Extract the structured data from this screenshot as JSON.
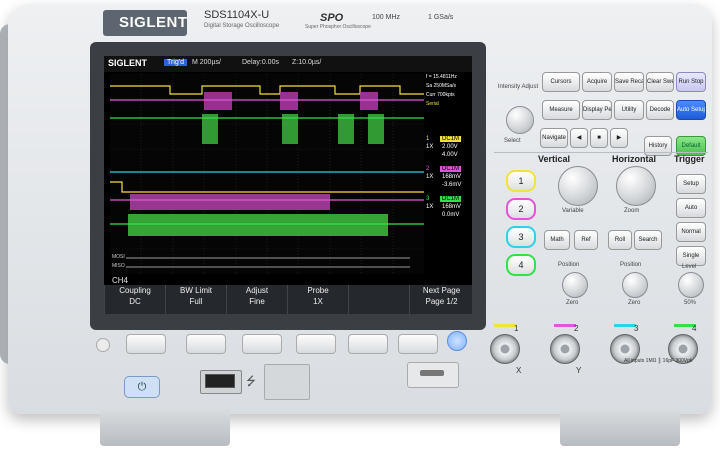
{
  "brand": "SIGLENT",
  "model": {
    "name": "SDS1104X-U",
    "subtitle": "Digital Storage Oscilloscope",
    "spo": "SPO",
    "spo_subtitle": "Super Phosphor Oscilloscope",
    "bandwidth": "100 MHz",
    "sample_rate": "1 GSa/s"
  },
  "screen": {
    "logo": "SIGLENT",
    "trig_status": "Trig'd",
    "timebase": "M 200µs/",
    "delay": "Delay:0.00s",
    "zoom": "Z:10.0µs/",
    "right_panel": {
      "freq": "f = 15.4811Hz",
      "sample": "Sa 250MSa/s",
      "curr": "Curr 700kpts",
      "trig": "Serial",
      "ch1_block": [
        "1",
        "1X",
        "DC1M",
        "2.00V",
        "4.00V"
      ],
      "ch2_block": [
        "2",
        "1X",
        "DC1M",
        "168mV",
        "-3.6mV"
      ],
      "ch3_block": [
        "3",
        "1X",
        "DC1M",
        "168mV",
        "0.0mV"
      ]
    },
    "bus_labels": [
      "MOSI",
      "MISO"
    ],
    "channel_label": "CH4",
    "menu": [
      {
        "top": "Coupling",
        "bottom": "DC"
      },
      {
        "top": "BW Limit",
        "bottom": "Full"
      },
      {
        "top": "Adjust",
        "bottom": "Fine"
      },
      {
        "top": "Probe",
        "bottom": "1X"
      },
      {
        "top": "",
        "bottom": ""
      },
      {
        "top": "Next Page",
        "bottom": "Page 1/2"
      }
    ]
  },
  "panel": {
    "intensity": "Intensity Adjust",
    "select": "Select",
    "buttons": {
      "cursors": "Cursors",
      "acquire": "Acquire",
      "save_recall": "Save Recall",
      "clear_sweeps": "Clear Sweeps",
      "run_stop": "Run Stop",
      "measure": "Measure",
      "display_persist": "Display Persist",
      "utility": "Utility",
      "decode": "Decode",
      "auto_setup": "Auto Setup",
      "navigate": "Navigate",
      "history": "History",
      "default": "Default",
      "math": "Math",
      "ref": "Ref",
      "roll": "Roll",
      "search": "Search",
      "setup": "Setup",
      "auto": "Auto",
      "normal": "Normal",
      "single": "Single"
    },
    "sections": {
      "vertical": "Vertical",
      "horizontal": "Horizontal",
      "trigger": "Trigger"
    },
    "knob_labels": {
      "variable": "Variable",
      "zoom": "Zoom",
      "position": "Position",
      "position_h": "Position",
      "zero": "Zero",
      "zero_h": "Zero",
      "level": "Level",
      "fifty": "50%"
    },
    "channels": [
      "1",
      "2",
      "3",
      "4"
    ]
  },
  "inputs": {
    "labels": [
      "1",
      "2",
      "3",
      "4"
    ],
    "x": "X",
    "y": "Y",
    "warning": "All inputs  1MΩ ║ 16pF  300Vpk"
  },
  "colors": {
    "ch1": "#f2e23a",
    "ch2": "#e056d8",
    "ch3": "#2fd1e6",
    "ch4": "#33e04a"
  }
}
